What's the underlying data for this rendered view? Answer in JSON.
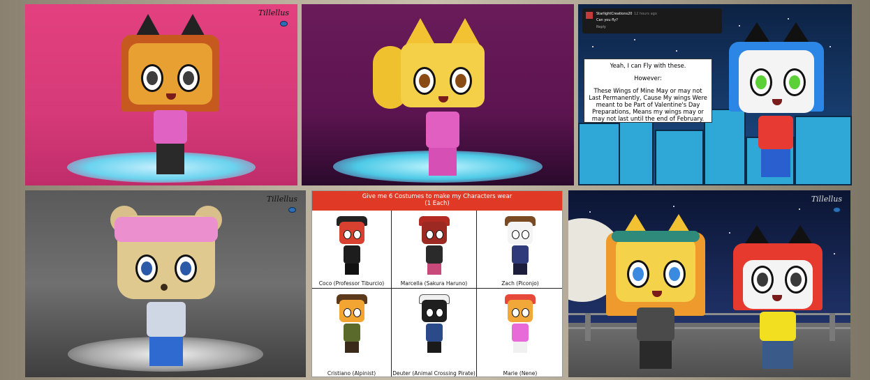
{
  "signature": "Tillellus",
  "tile3": {
    "comment": {
      "username": "StarlightCreations20",
      "time": "12 hours ago",
      "text": "Can you fly?",
      "reply": "Reply"
    },
    "speech": {
      "line1": "Yeah, I can Fly with these.",
      "line2": "However:",
      "line3": "These Wings of Mine May or may not Last Permanently, Cause My wings Were meant to be Part of Valentine's Day Preparations, Means my wings may or may not last until the end of February."
    }
  },
  "costumes": {
    "title_line1": "Give me 6 Costumes to make my Characters wear",
    "title_line2": "(1 Each)",
    "cells": [
      {
        "caption": "Coco (Professor Tiburcio)"
      },
      {
        "caption": "Marcella (Sakura Haruno)"
      },
      {
        "caption": "Zach (Piconjo)"
      },
      {
        "caption": "Cristiano (Alpinist)"
      },
      {
        "caption": "Deuter (Animal Crossing Pirate)"
      },
      {
        "caption": "Marie (Nene)"
      }
    ]
  },
  "colors": {
    "tile1_bg": "#e3407e",
    "tile2_bg": "#6a1b5a",
    "tile3_bg": "#163a6a",
    "tile4_bg": "#5a5a5a",
    "tile6_bg": "#1c2d60",
    "banner": "#e03a26"
  }
}
